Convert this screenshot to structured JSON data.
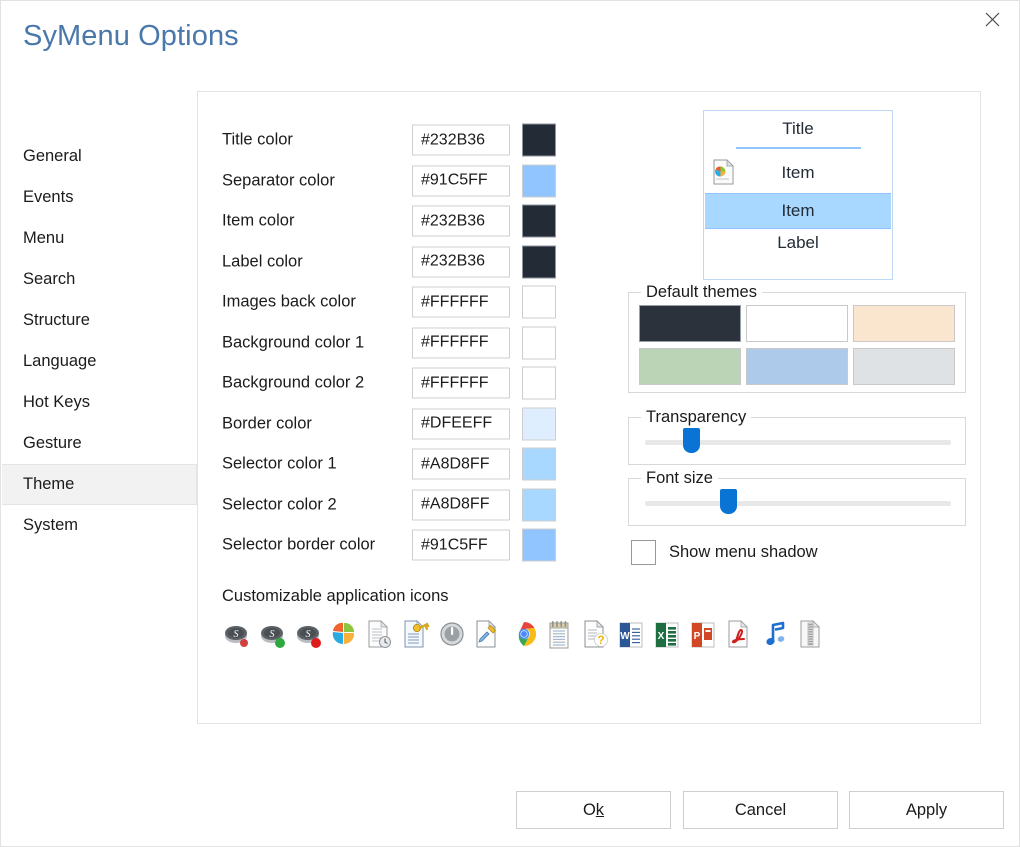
{
  "window": {
    "title": "SyMenu Options",
    "close_icon": "close-icon"
  },
  "sidebar": {
    "items": [
      {
        "label": "General",
        "selected": false
      },
      {
        "label": "Events",
        "selected": false
      },
      {
        "label": "Menu",
        "selected": false
      },
      {
        "label": "Search",
        "selected": false
      },
      {
        "label": "Structure",
        "selected": false
      },
      {
        "label": "Language",
        "selected": false
      },
      {
        "label": "Hot Keys",
        "selected": false
      },
      {
        "label": "Gesture",
        "selected": false
      },
      {
        "label": "Theme",
        "selected": true
      },
      {
        "label": "System",
        "selected": false
      }
    ]
  },
  "colors": {
    "rows": [
      {
        "label": "Title color",
        "value": "#232B36",
        "swatch": "#232B36"
      },
      {
        "label": "Separator color",
        "value": "#91C5FF",
        "swatch": "#91C5FF"
      },
      {
        "label": "Item color",
        "value": "#232B36",
        "swatch": "#232B36"
      },
      {
        "label": "Label color",
        "value": "#232B36",
        "swatch": "#232B36"
      },
      {
        "label": "Images back color",
        "value": "#FFFFFF",
        "swatch": "#FFFFFF"
      },
      {
        "label": "Background color 1",
        "value": "#FFFFFF",
        "swatch": "#FFFFFF"
      },
      {
        "label": "Background color 2",
        "value": "#FFFFFF",
        "swatch": "#FFFFFF"
      },
      {
        "label": "Border color",
        "value": "#DFEEFF",
        "swatch": "#DFEEFF"
      },
      {
        "label": "Selector color 1",
        "value": "#A8D8FF",
        "swatch": "#A8D8FF"
      },
      {
        "label": "Selector color 2",
        "value": "#A8D8FF",
        "swatch": "#A8D8FF"
      },
      {
        "label": "Selector border color",
        "value": "#91C5FF",
        "swatch": "#91C5FF"
      }
    ]
  },
  "icons_section": {
    "title": "Customizable application icons",
    "icons": [
      {
        "name": "symenu-disk-icon"
      },
      {
        "name": "symenu-disk-green-icon"
      },
      {
        "name": "symenu-disk-red-icon"
      },
      {
        "name": "windows-logo-icon"
      },
      {
        "name": "document-clock-icon"
      },
      {
        "name": "document-key-icon"
      },
      {
        "name": "power-shutdown-icon"
      },
      {
        "name": "document-edit-icon"
      },
      {
        "name": "chrome-browser-icon"
      },
      {
        "name": "notepad-icon"
      },
      {
        "name": "help-question-icon"
      },
      {
        "name": "word-document-icon"
      },
      {
        "name": "excel-spreadsheet-icon"
      },
      {
        "name": "powerpoint-presentation-icon"
      },
      {
        "name": "pdf-document-icon"
      },
      {
        "name": "music-note-icon"
      },
      {
        "name": "zip-archive-icon"
      }
    ]
  },
  "preview": {
    "title": "Title",
    "item1": "Item",
    "item2": "Item",
    "label": "Label",
    "doc_icon": "document-windows-icon",
    "title_color": "#232B36",
    "separator_color": "#91C5FF",
    "selector_color": "#A8D8FF",
    "selector_border_color": "#91C5FF",
    "border_color": "#BCD8F5"
  },
  "themes": {
    "title": "Default themes",
    "swatches": [
      {
        "name": "theme-dark",
        "color": "#2B323C"
      },
      {
        "name": "theme-white",
        "color": "#FFFFFF"
      },
      {
        "name": "theme-peach",
        "color": "#FAE5CE"
      },
      {
        "name": "theme-green",
        "color": "#BAD4B5"
      },
      {
        "name": "theme-blue",
        "color": "#AECAEA"
      },
      {
        "name": "theme-gray",
        "color": "#DFE2E5"
      }
    ]
  },
  "transparency": {
    "title": "Transparency",
    "value_percent": 13
  },
  "font_size": {
    "title": "Font size",
    "value_percent": 26
  },
  "shadow": {
    "label": "Show menu shadow",
    "checked": false
  },
  "footer": {
    "ok": {
      "prefix": "O",
      "accel": "k",
      "suffix": ""
    },
    "cancel": "Cancel",
    "apply": "Apply"
  },
  "accent": {
    "title_blue": "#4A78AB",
    "slider_blue": "#0A74D4"
  }
}
